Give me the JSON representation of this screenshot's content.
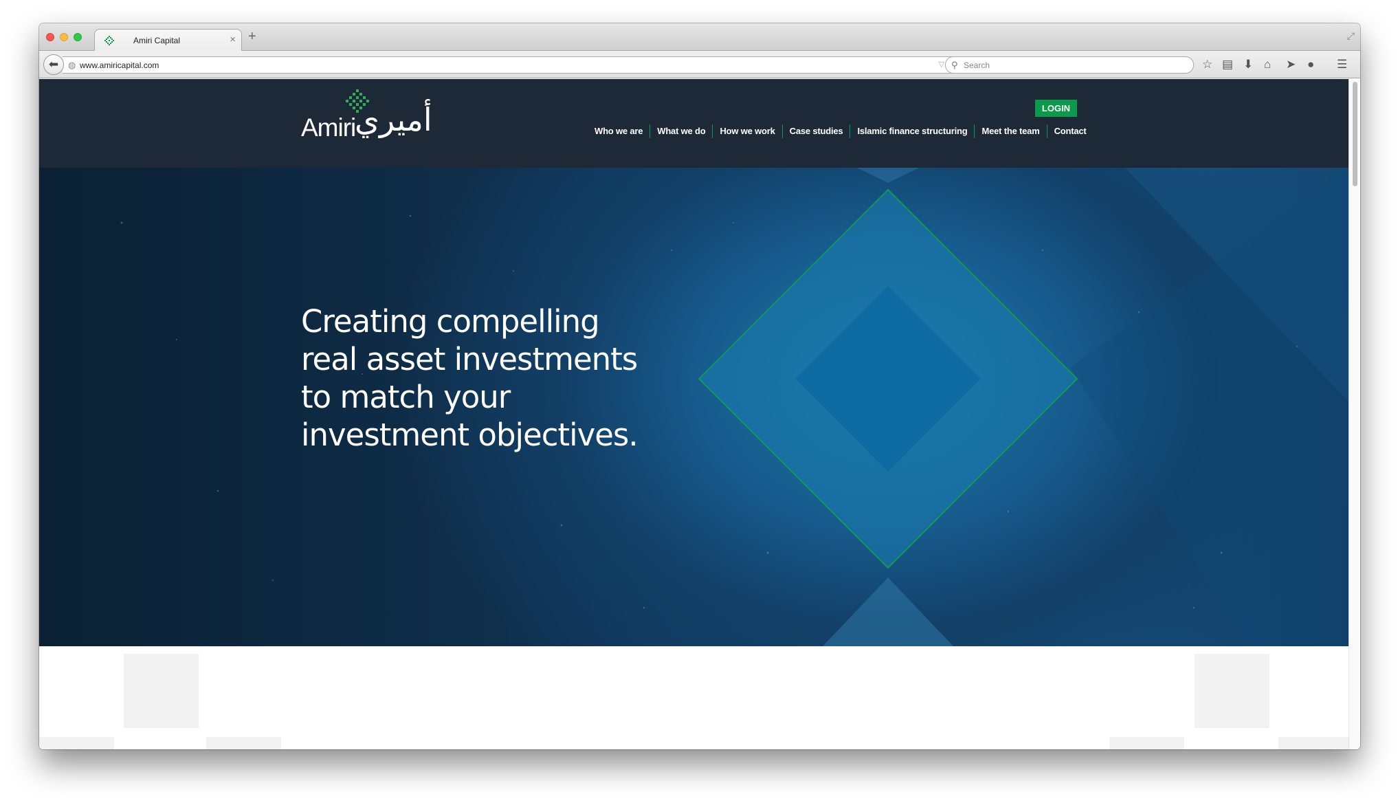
{
  "browser": {
    "tab_title": "Amiri Capital",
    "tab_close": "×",
    "new_tab": "+",
    "url": "www.amiricapital.com",
    "search_placeholder": "Search"
  },
  "site": {
    "logo_text": "Amiri",
    "logo_arabic": "أميري",
    "login_label": "LOGIN",
    "nav": [
      "Who we are",
      "What we do",
      "How we work",
      "Case studies",
      "Islamic finance structuring",
      "Meet the team",
      "Contact"
    ],
    "hero_heading": "Creating compelling real asset investments to match your investment objectives."
  },
  "colors": {
    "header_bg": "#1e2937",
    "accent_green": "#0b9a4c",
    "hero_blue": "#175b8e"
  },
  "icons": [
    "back-arrow-icon",
    "globe-icon",
    "reload-icon",
    "search-icon",
    "bookmark-star-icon",
    "reading-list-icon",
    "download-icon",
    "home-icon",
    "send-icon",
    "chat-icon",
    "menu-icon",
    "fullscreen-icon"
  ]
}
